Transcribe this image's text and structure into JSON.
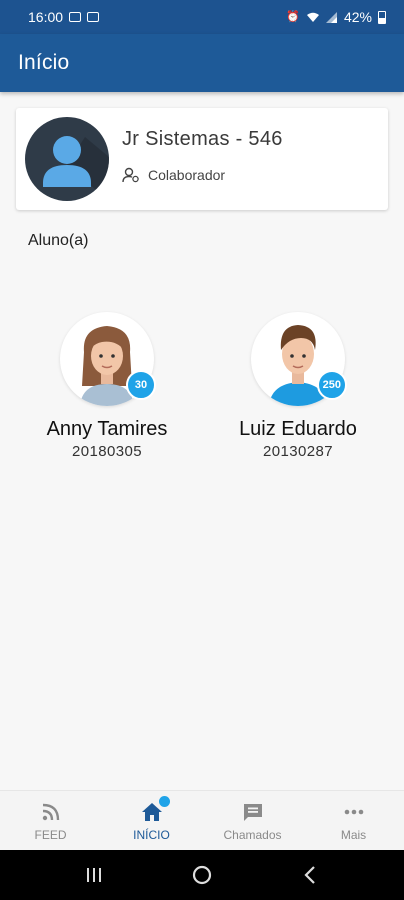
{
  "status_bar": {
    "time": "16:00",
    "battery": "42%"
  },
  "app_bar": {
    "title": "Início"
  },
  "profile": {
    "name": "Jr Sistemas - 546",
    "role": "Colaborador"
  },
  "section": {
    "label": "Aluno(a)"
  },
  "students": [
    {
      "name": "Anny Tamires",
      "id": "20180305",
      "badge": "30"
    },
    {
      "name": "Luiz Eduardo",
      "id": "20130287",
      "badge": "250"
    }
  ],
  "bottom_nav": {
    "items": [
      {
        "label": "FEED",
        "icon": "rss-icon"
      },
      {
        "label": "INÍCIO",
        "icon": "home-icon"
      },
      {
        "label": "Chamados",
        "icon": "chat-icon"
      },
      {
        "label": "Mais",
        "icon": "more-icon"
      }
    ]
  },
  "colors": {
    "primary": "#1e5a98",
    "status_bar": "#1d5390",
    "badge": "#1fa3e8"
  }
}
